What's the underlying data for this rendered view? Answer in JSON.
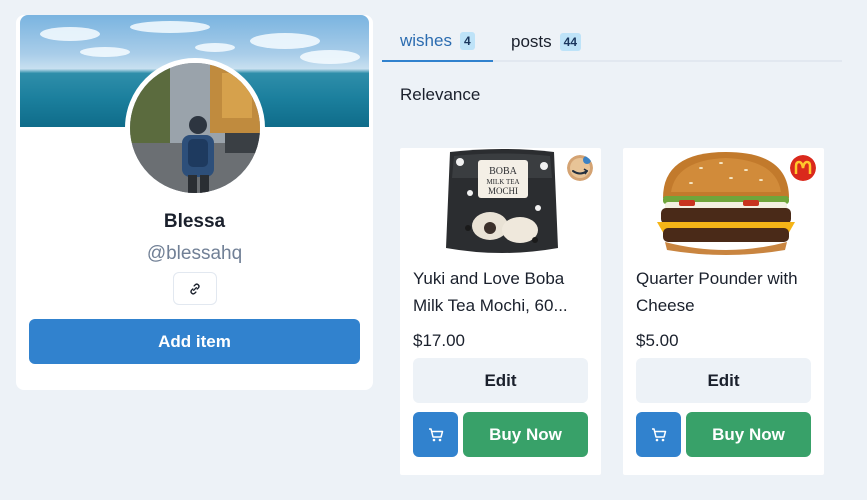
{
  "profile": {
    "name": "Blessa",
    "handle": "@blessahq",
    "link_icon": "link-icon",
    "add_item_label": "Add item",
    "banner_icon": "ocean-banner-image",
    "avatar_icon": "person-avatar-photo"
  },
  "tabs": [
    {
      "label": "wishes",
      "count": "4",
      "active": true
    },
    {
      "label": "posts",
      "count": "44",
      "active": false
    }
  ],
  "sort": {
    "label": "Relevance"
  },
  "products": [
    {
      "title": "Yuki and Love Boba Milk Tea Mochi, 60...",
      "price": "$17.00",
      "store_icon": "amazon-logo",
      "image_icon": "mochi-package-image",
      "edit_label": "Edit",
      "cart_icon": "cart-icon",
      "buy_label": "Buy Now"
    },
    {
      "title": "Quarter Pounder with Cheese",
      "price": "$5.00",
      "store_icon": "mcdonalds-logo",
      "image_icon": "burger-image",
      "edit_label": "Edit",
      "cart_icon": "cart-icon",
      "buy_label": "Buy Now"
    }
  ],
  "colors": {
    "page_bg": "#edf2f7",
    "primary": "#3182ce",
    "success": "#38a169",
    "tab_active": "#2b6cb0",
    "badge_bg": "#bee3f8"
  }
}
